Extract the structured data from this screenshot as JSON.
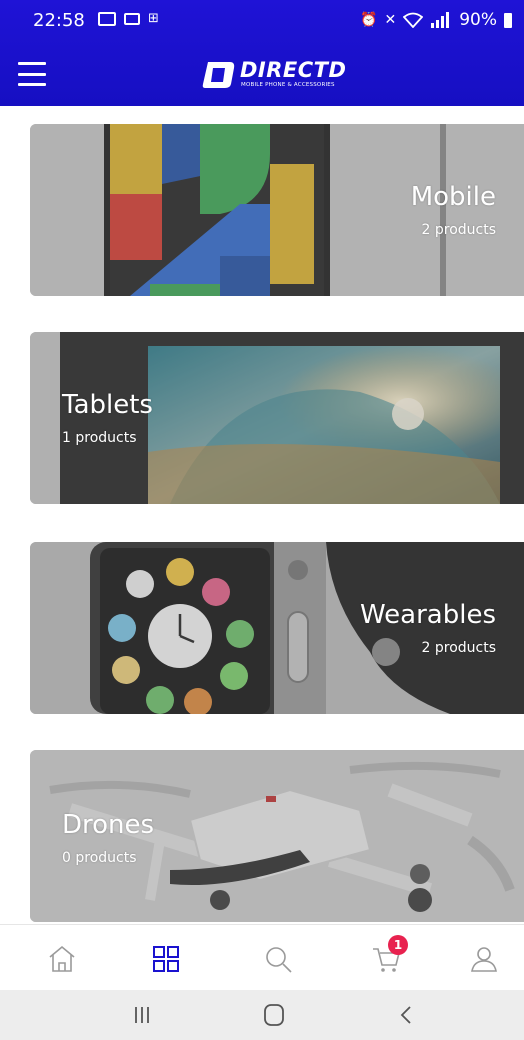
{
  "status_bar": {
    "time": "22:58",
    "battery": "90%",
    "left_icons": [
      "image-icon",
      "cast-icon",
      "notification-icon"
    ],
    "right_icons": [
      "alarm-icon",
      "mute-icon",
      "wifi-icon",
      "signal-icon",
      "battery-icon"
    ]
  },
  "app_bar": {
    "logo_text": "DIRECTD",
    "logo_subtext": "MOBILE PHONE & ACCESSORIES",
    "brand_color": "#1a12cf"
  },
  "categories": [
    {
      "name": "Mobile",
      "count": "2 products"
    },
    {
      "name": "Tablets",
      "count": "1 products"
    },
    {
      "name": "Wearables",
      "count": "2 products"
    },
    {
      "name": "Drones",
      "count": "0 products"
    }
  ],
  "bottom_nav": {
    "items": [
      "home-icon",
      "categories-icon",
      "search-icon",
      "cart-icon",
      "account-icon"
    ],
    "active": "categories-icon",
    "active_color": "#1a12cf",
    "cart_badge": "1",
    "badge_color": "#e8224f"
  },
  "system_nav": [
    "recents-button",
    "home-button",
    "back-button"
  ]
}
